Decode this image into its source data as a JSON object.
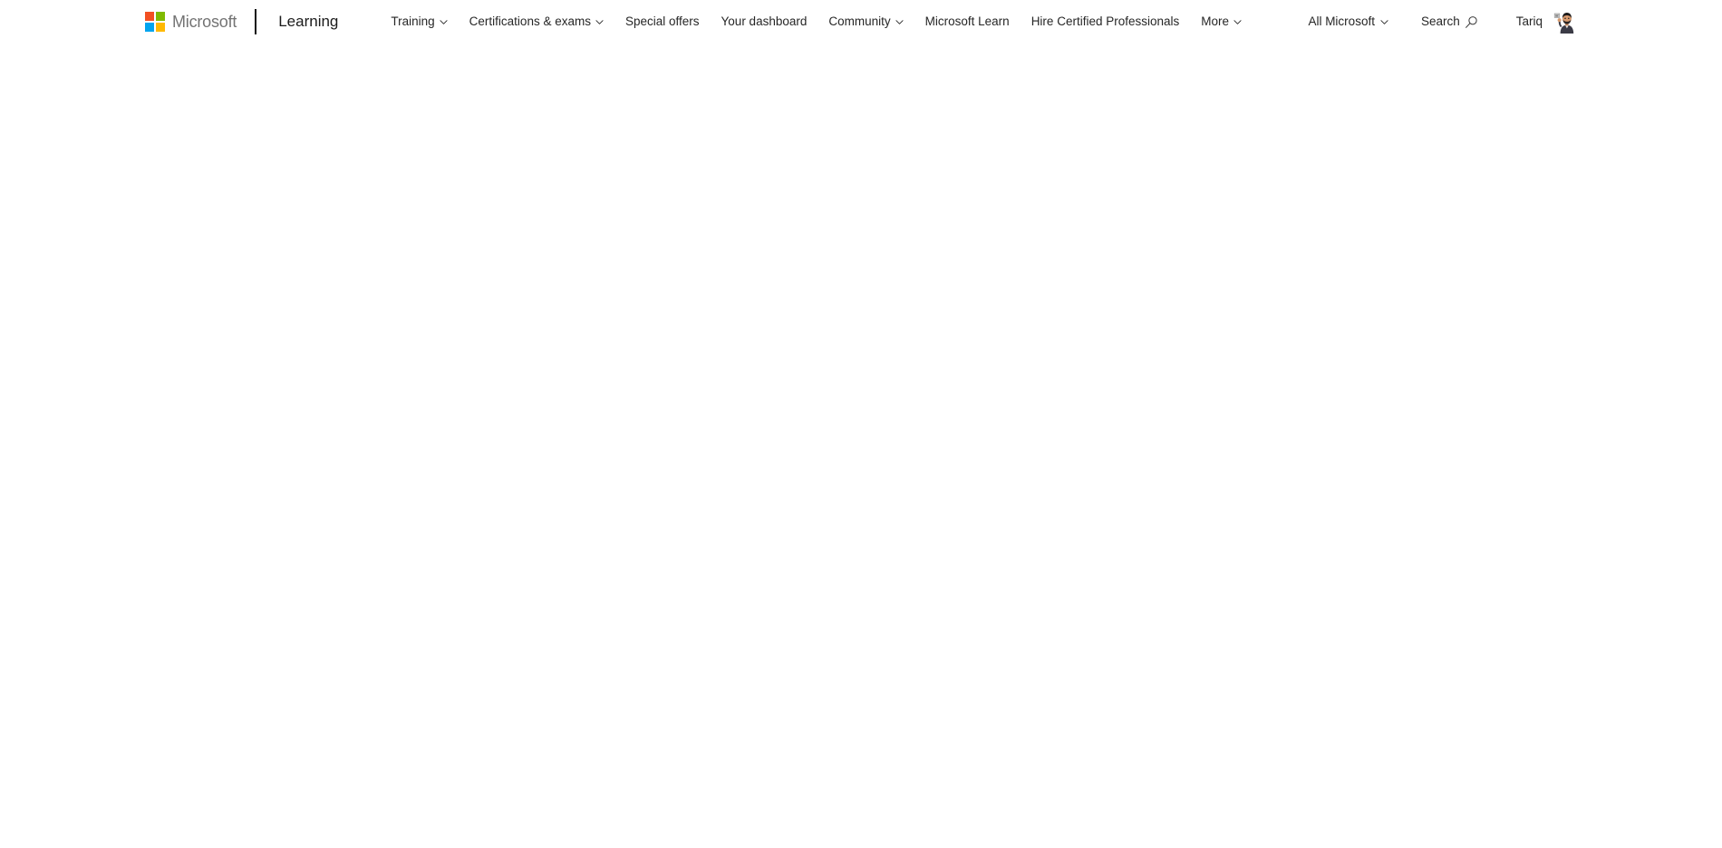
{
  "colors": {
    "brand_red": "#F25022",
    "brand_green": "#7FBA00",
    "brand_blue": "#00A4EF",
    "brand_yellow": "#FFB900",
    "page_background": "#FFFFFF",
    "header_background": "#FFFFFF",
    "nav_text": "#262626",
    "wordmark_text": "#737373",
    "site_name_text": "#1B1B1B",
    "divider": "#111111"
  },
  "header": {
    "logo_icon": "microsoft-logo-icon",
    "wordmark": "Microsoft",
    "divider": "|",
    "site_name": "Learning",
    "nav_items": [
      {
        "label": "Training",
        "has_dropdown": true,
        "icon": "chevron-down-icon"
      },
      {
        "label": "Certifications & exams",
        "has_dropdown": true,
        "icon": "chevron-down-icon"
      },
      {
        "label": "Special offers",
        "has_dropdown": false,
        "icon": ""
      },
      {
        "label": "Your dashboard",
        "has_dropdown": false,
        "icon": ""
      },
      {
        "label": "Community",
        "has_dropdown": true,
        "icon": "chevron-down-icon"
      },
      {
        "label": "Microsoft Learn",
        "has_dropdown": false,
        "icon": ""
      },
      {
        "label": "Hire Certified Professionals",
        "has_dropdown": false,
        "icon": ""
      },
      {
        "label": "More",
        "has_dropdown": true,
        "icon": "chevron-down-icon"
      }
    ],
    "all_microsoft": {
      "label": "All Microsoft",
      "icon": "chevron-down-icon"
    },
    "search": {
      "label": "Search",
      "icon": "search-icon"
    },
    "account": {
      "name": "Tariq",
      "avatar_icon": "user-avatar-icon"
    }
  },
  "main": {
    "state": "empty",
    "content": ""
  }
}
